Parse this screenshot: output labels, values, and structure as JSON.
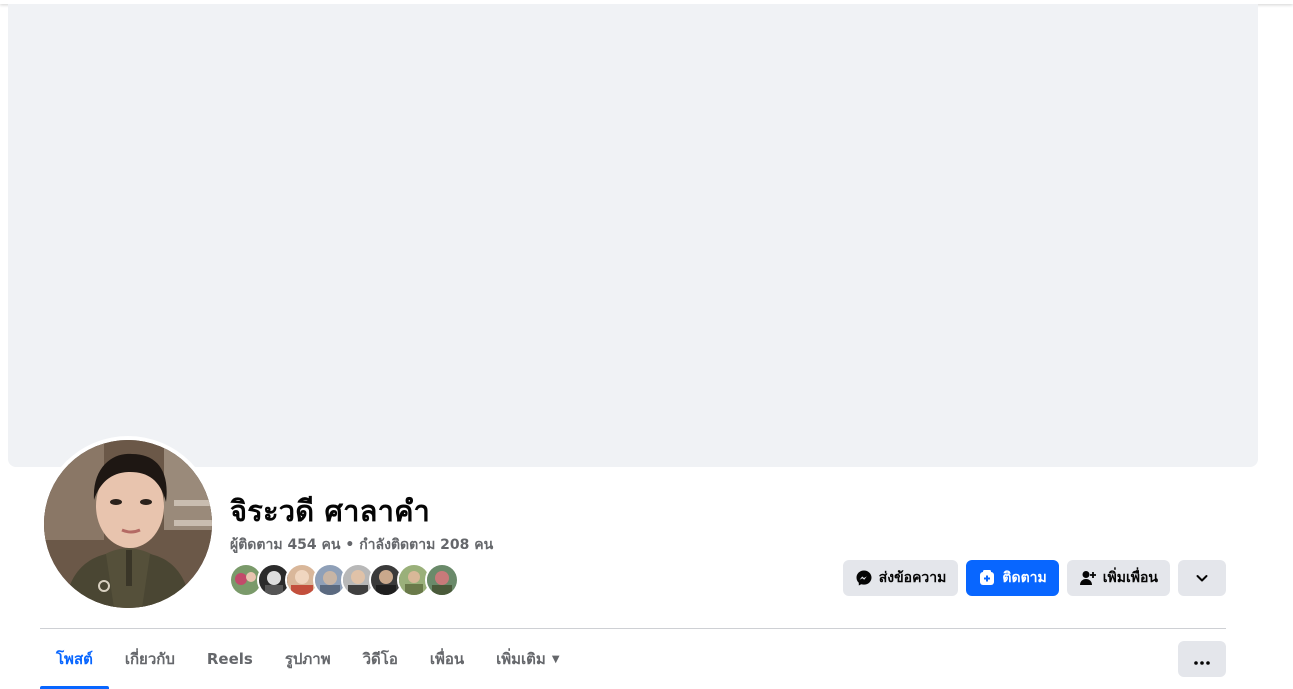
{
  "profile": {
    "name": "จิระวดี ศาลาคำ",
    "followers_text": "ผู้ติดตาม 454 คน",
    "separator": "•",
    "following_text": "กำลังติดตาม 208 คน"
  },
  "mutual_friends_count_shown": 8,
  "actions": {
    "message_label": "ส่งข้อความ",
    "message_icon": "messenger-icon",
    "follow_label": "ติดตาม",
    "follow_icon": "follow-icon",
    "add_friend_label": "เพิ่มเพื่อน",
    "add_friend_icon": "add-friend-icon",
    "dropdown_icon": "chevron-down-icon"
  },
  "tabs": [
    {
      "label": "โพสต์",
      "active": true
    },
    {
      "label": "เกี่ยวกับ",
      "active": false
    },
    {
      "label": "Reels",
      "active": false
    },
    {
      "label": "รูปภาพ",
      "active": false
    },
    {
      "label": "วิดีโอ",
      "active": false
    },
    {
      "label": "เพื่อน",
      "active": false
    },
    {
      "label": "เพิ่มเติม",
      "active": false
    }
  ],
  "colors": {
    "accent": "#0866ff",
    "cover_bg": "#f0f2f5",
    "button_gray": "#e4e6eb",
    "secondary_text": "#65676b"
  }
}
